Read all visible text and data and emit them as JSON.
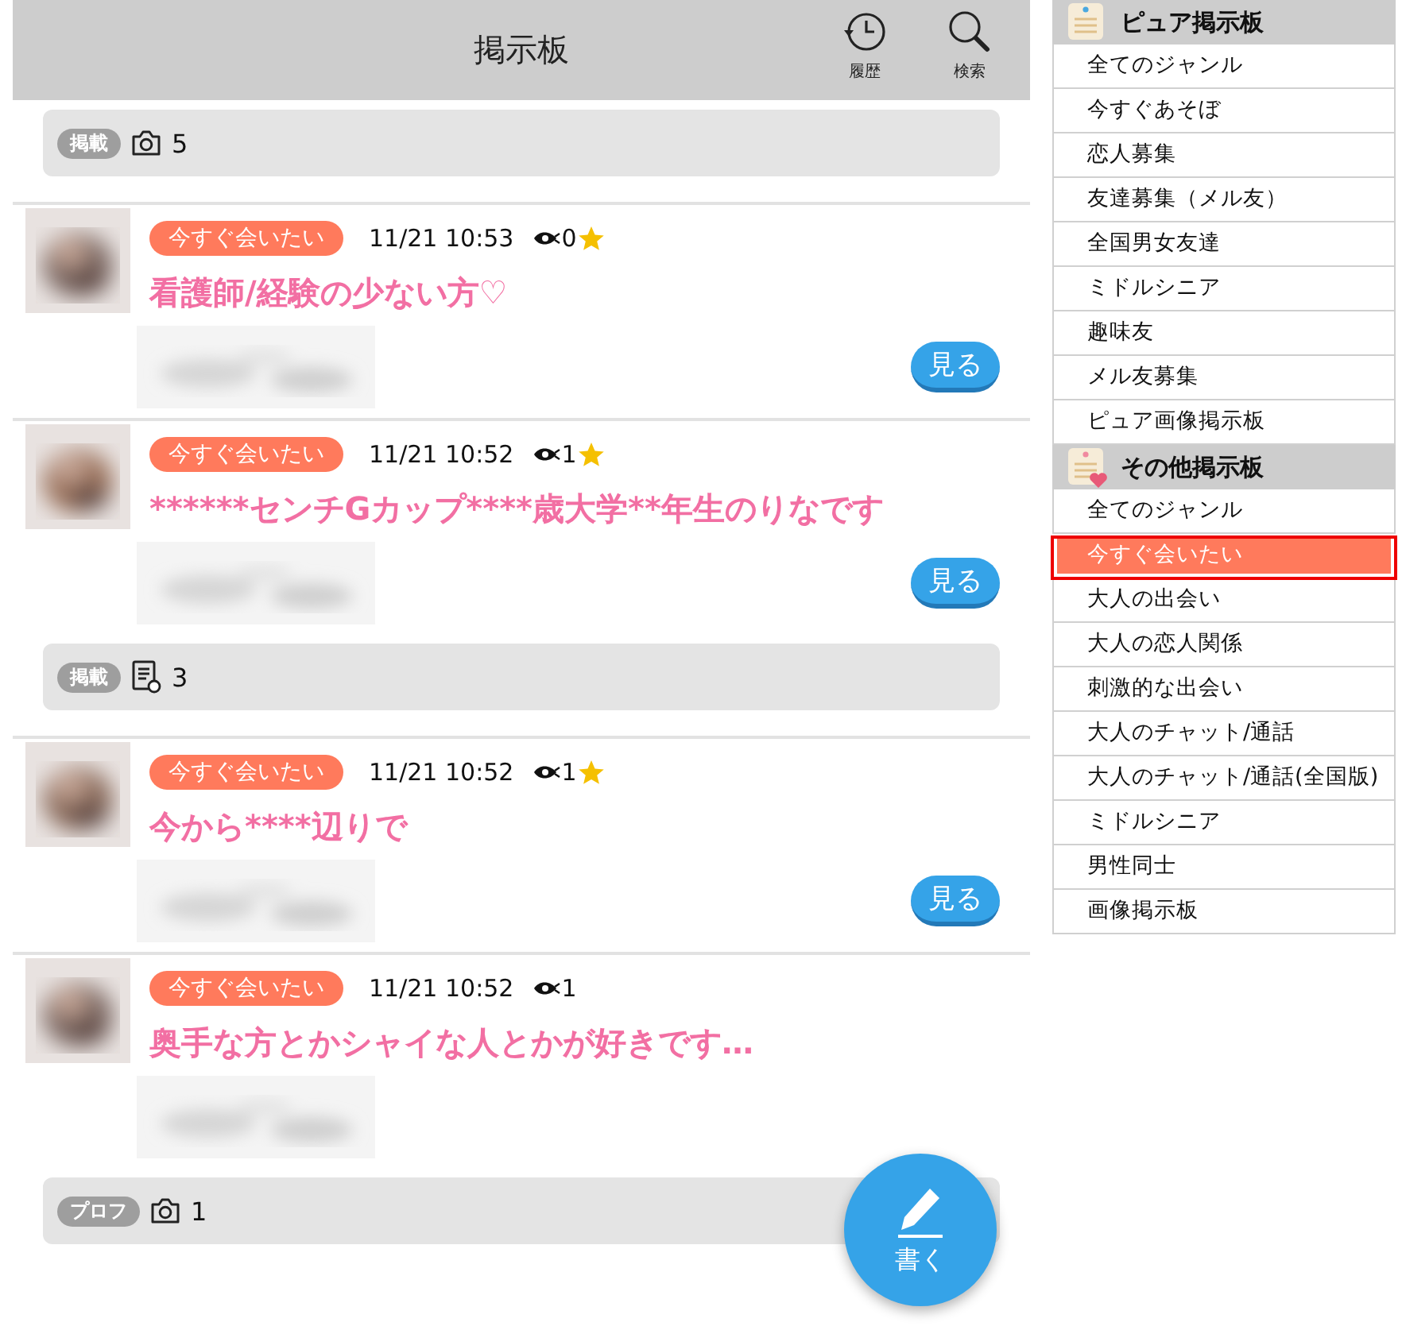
{
  "header": {
    "title": "掲示板",
    "actions": [
      {
        "kind": "history",
        "label": "履歴"
      },
      {
        "kind": "search",
        "label": "検索"
      }
    ]
  },
  "feed": [
    {
      "kind": "strip",
      "tag": "掲載",
      "media": {
        "kind": "camera",
        "count": "5"
      }
    },
    {
      "kind": "post",
      "category": "今すぐ会いたい",
      "time": "11/21 10:53",
      "views": "0",
      "starred": true,
      "title": "看護師/経験の少ない方♡",
      "button": "見る"
    },
    {
      "kind": "post",
      "category": "今すぐ会いたい",
      "time": "11/21 10:52",
      "views": "1",
      "starred": true,
      "title": "******センチGカップ****歳大学**年生のりなです",
      "button": "見る"
    },
    {
      "kind": "strip",
      "tag": "掲載",
      "media": {
        "kind": "document",
        "count": "3"
      }
    },
    {
      "kind": "post",
      "category": "今すぐ会いたい",
      "time": "11/21 10:52",
      "views": "1",
      "starred": true,
      "title": "今から****辺りで",
      "button": "見る"
    },
    {
      "kind": "post",
      "category": "今すぐ会いたい",
      "time": "11/21 10:52",
      "views": "1",
      "starred": false,
      "title": "奥手な方とかシャイな人とかが好きです…"
    },
    {
      "kind": "strip",
      "tag": "プロフ",
      "media": {
        "kind": "camera",
        "count": "1"
      }
    }
  ],
  "fab": {
    "label": "書く"
  },
  "sidebar": {
    "sections": [
      {
        "kind": "pure",
        "title": "ピュア掲示板",
        "items": [
          {
            "label": "全てのジャンル",
            "selected": false
          },
          {
            "label": "今すぐあそぼ",
            "selected": false
          },
          {
            "label": "恋人募集",
            "selected": false
          },
          {
            "label": "友達募集（メル友）",
            "selected": false
          },
          {
            "label": "全国男女友達",
            "selected": false
          },
          {
            "label": "ミドルシニア",
            "selected": false
          },
          {
            "label": "趣味友",
            "selected": false
          },
          {
            "label": "メル友募集",
            "selected": false
          },
          {
            "label": "ピュア画像掲示板",
            "selected": false
          }
        ]
      },
      {
        "kind": "other",
        "title": "その他掲示板",
        "items": [
          {
            "label": "全てのジャンル",
            "selected": false
          },
          {
            "label": "今すぐ会いたい",
            "selected": true
          },
          {
            "label": "大人の出会い",
            "selected": false
          },
          {
            "label": "大人の恋人関係",
            "selected": false
          },
          {
            "label": "刺激的な出会い",
            "selected": false
          },
          {
            "label": "大人のチャット/通話",
            "selected": false
          },
          {
            "label": "大人のチャット/通話(全国版)",
            "selected": false
          },
          {
            "label": "ミドルシニア",
            "selected": false
          },
          {
            "label": "男性同士",
            "selected": false
          },
          {
            "label": "画像掲示板",
            "selected": false
          }
        ]
      }
    ]
  }
}
